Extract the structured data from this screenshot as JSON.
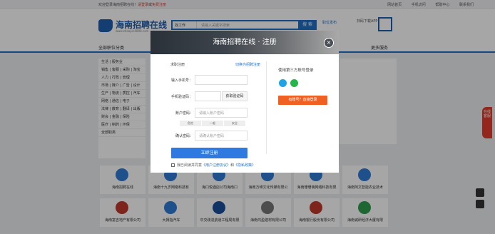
{
  "topbar": {
    "welcome_prefix": "欢迎登录海南招聘在线！",
    "login": "请登录",
    "sep": "或",
    "register": "免费注册",
    "links": [
      "网站首页",
      "手机访问",
      "帮助中心",
      "联系我们"
    ]
  },
  "header": {
    "logo_text": "海南招聘在线",
    "logo_sub": "www.zhaopin0898.com",
    "search_type": "找工作",
    "search_placeholder": "请输入关键字搜索",
    "search_button": "搜 索",
    "publish": "职位发布",
    "qr_label": "扫码下载APP"
  },
  "nav": {
    "all_categories": "全部职位分类",
    "more": "更多服务"
  },
  "categories": [
    "生活 | 服务业",
    "销售 | 客服 | 采购 | 淘宝",
    "人力 | 行政 | 管理",
    "市场 | 媒介 | 广告 | 设计",
    "生产 | 物流 | 质控 | 汽车",
    "网络 | 通信 | 电子",
    "法律 | 教育 | 翻译 | 出版",
    "财会 | 金融 | 保险",
    "医疗 | 制药 | 环保",
    "全部职类"
  ],
  "companies_row1": [
    "海南招聘在线",
    "海南十九岁网络科技有",
    "海口悦酒店公司海南口",
    "海南万维文化传媒有限公",
    "海南珊珊萌网络科技有限",
    "海南阿文智能农业技术"
  ],
  "companies_row2": [
    "海南富吉地产有限公司",
    "大拇指汽车",
    "中交疏浚航道工程局有限",
    "海南鸿盈建材有限公司",
    "海南银行股份有限公司",
    "海南诚研经济大厦有限"
  ],
  "side_tab": "在线客服",
  "modal": {
    "title": "海南招聘在线 · 注册",
    "close": "×",
    "left_title": "求职注册",
    "switch": "切换为招聘注册",
    "phone_label": "输入手机号：",
    "code_label": "手机验证码：",
    "code_button": "获取验证码",
    "pwd_label": "账户密码：",
    "pwd_placeholder": "请输入账户密码",
    "strength": [
      "危险",
      "一般",
      "安全"
    ],
    "confirm_label": "确认密码：",
    "confirm_placeholder": "请确认账户密码",
    "submit": "立即注册",
    "agree_prefix": "我已阅读并同意",
    "agreement": "《用户注册协议》",
    "and": "和",
    "privacy": "《隐私政策》",
    "right_title": "使用第三方账号登录",
    "login_button": "有账号？直接登录"
  }
}
